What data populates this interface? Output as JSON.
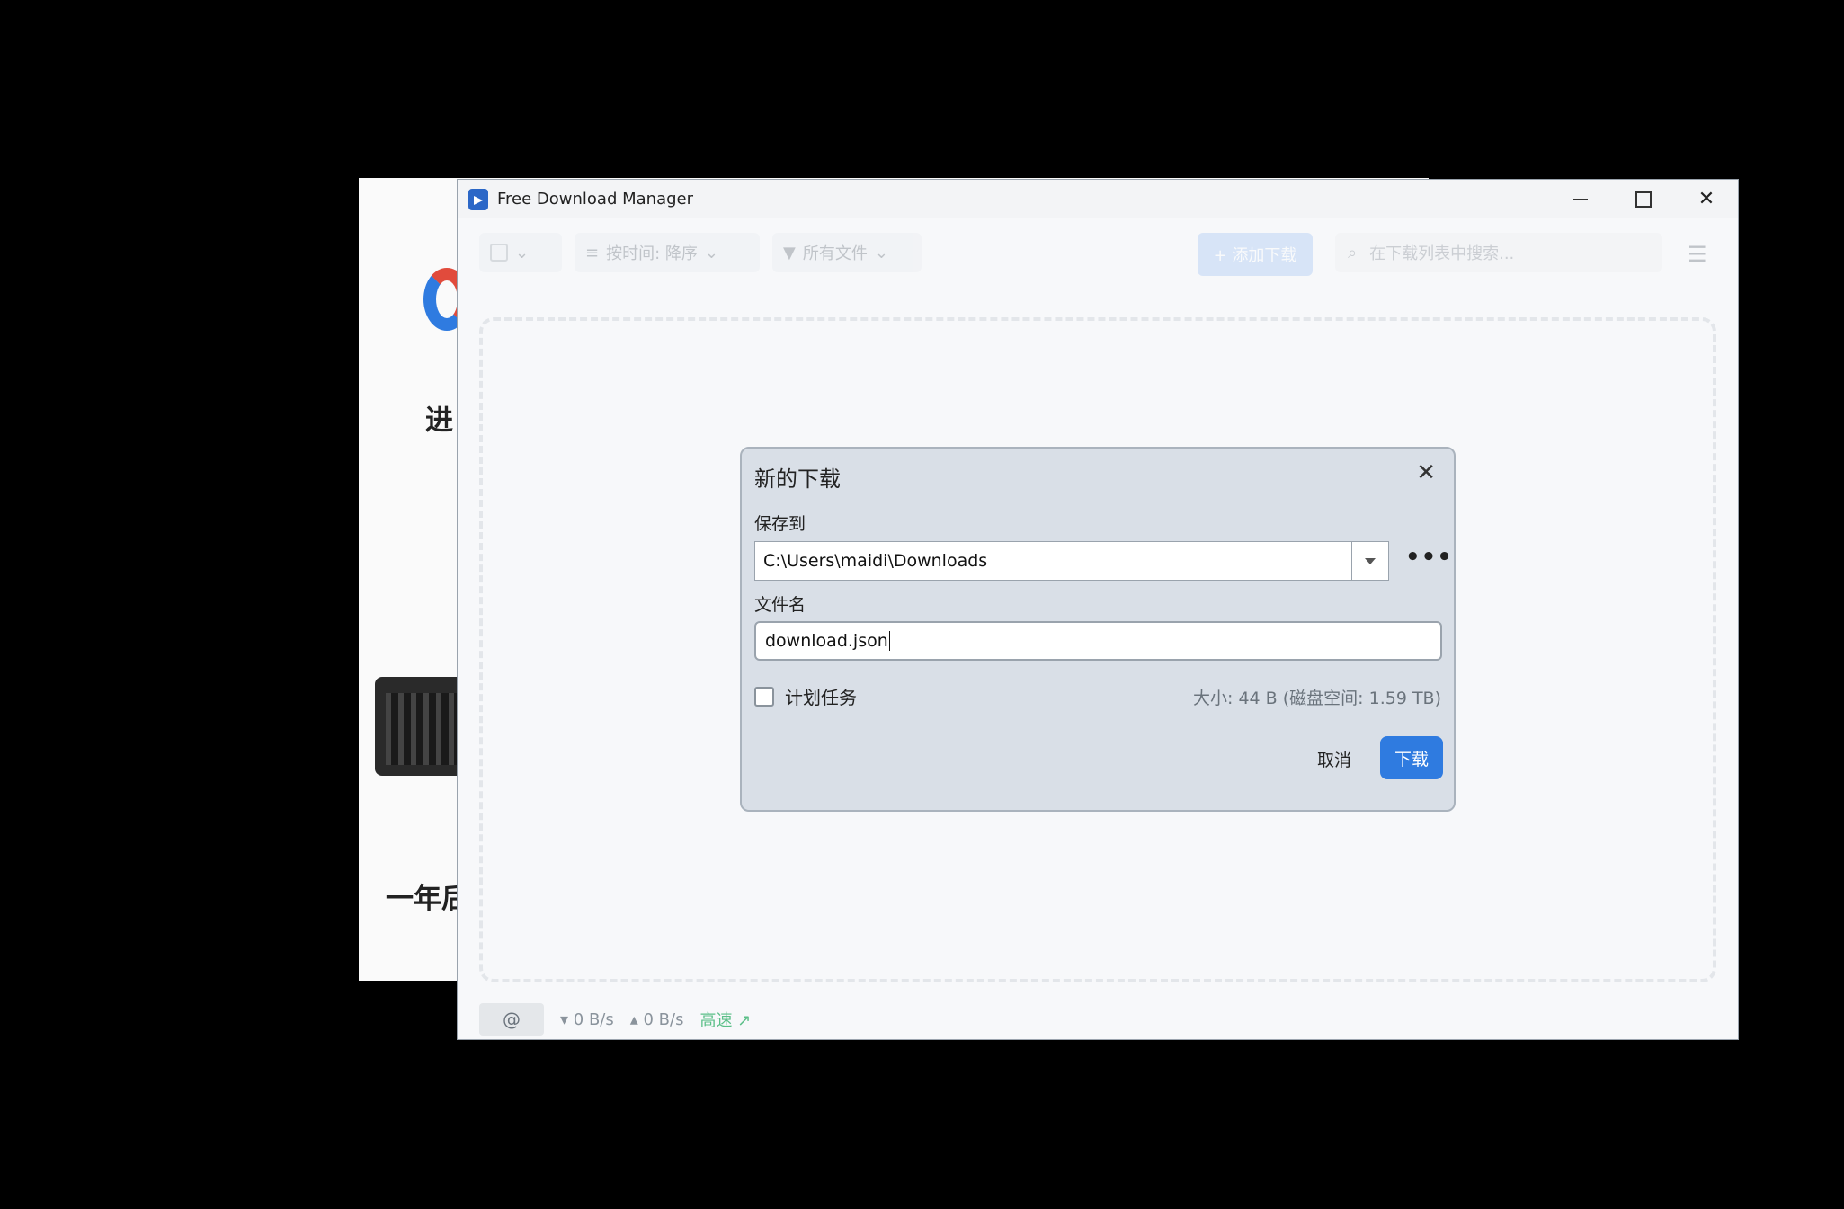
{
  "background": {
    "text1": "进",
    "text2": "一年后"
  },
  "window": {
    "title": "Free Download Manager"
  },
  "toolbar": {
    "sort_label": "按时间: 降序",
    "filter_label": "所有文件",
    "add_label": "+ 添加下载",
    "search_placeholder": "在下载列表中搜索..."
  },
  "statusbar": {
    "download_speed": "0 B/s",
    "upload_speed": "0 B/s",
    "mode": "高速"
  },
  "dialog": {
    "title": "新的下载",
    "save_to_label": "保存到",
    "save_path": "C:\\Users\\maidi\\Downloads",
    "filename_label": "文件名",
    "filename": "download.json",
    "schedule_label": "计划任务",
    "size_info": "大小: 44 B (磁盘空间: 1.59 TB)",
    "cancel_label": "取消",
    "download_label": "下载"
  },
  "colors": {
    "accent": "#2f7be0",
    "dialog_bg": "#d9dfe7",
    "fast_mode": "#5bbf88"
  }
}
